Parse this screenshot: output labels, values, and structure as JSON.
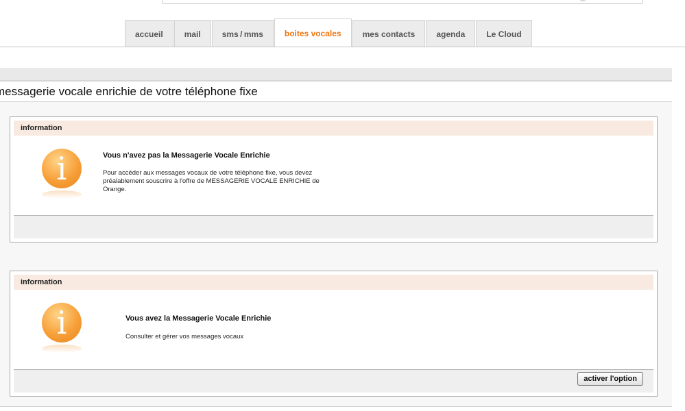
{
  "tabs": [
    {
      "label": "accueil"
    },
    {
      "label": "mail"
    },
    {
      "label": "sms / mms"
    },
    {
      "label": "boites vocales",
      "active": true
    },
    {
      "label": "mes contacts"
    },
    {
      "label": "agenda"
    },
    {
      "label": "Le Cloud"
    }
  ],
  "page": {
    "title": "messagerie vocale enrichie de votre téléphone fixe"
  },
  "panel1": {
    "header": "information",
    "icon": "info-icon",
    "title": "Vous n'avez pas la Messagerie Vocale Enrichie",
    "body": "Pour accéder aux messages vocaux de votre téléphone fixe, vous devez préalablement souscrire à l'offre de MESSAGERIE VOCALE ENRICHIE de Orange."
  },
  "panel2": {
    "header": "information",
    "icon": "info-icon",
    "title": "Vous avez la Messagerie Vocale Enrichie",
    "body": "Consulter et gérer vos messages vocaux",
    "button": "activer l'option"
  },
  "colors": {
    "accent": "#ef7512",
    "panel_header_bg": "#f8eae0"
  }
}
